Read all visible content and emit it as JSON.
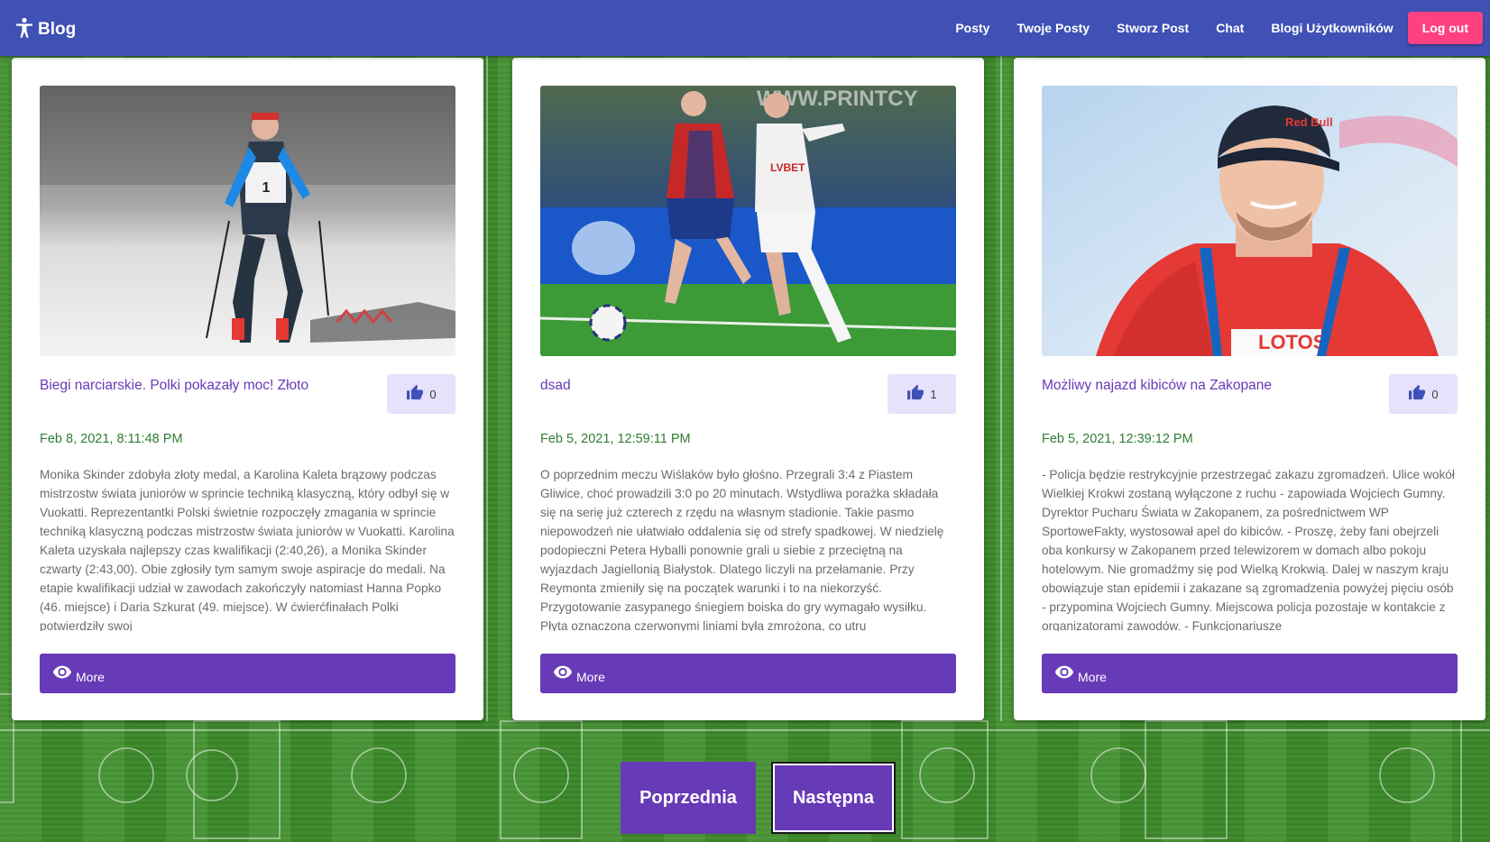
{
  "app": {
    "title": "Blog",
    "icon": "accessibility-icon"
  },
  "nav": {
    "items": [
      {
        "label": "Posty"
      },
      {
        "label": "Twoje Posty"
      },
      {
        "label": "Stworz Post"
      },
      {
        "label": "Chat"
      },
      {
        "label": "Blogi Użytkowników"
      }
    ],
    "logout_label": "Log out"
  },
  "posts": [
    {
      "title": "Biegi narciarskie. Polki pokazały moc! Złoto",
      "likes": "0",
      "date": "Feb 8, 2021, 8:11:48 PM",
      "body": "Monika Skinder zdobyła złoty medal, a Karolina Kaleta brązowy podczas mistrzostw świata juniorów w sprincie techniką klasyczną, który odbył się w Vuokatti. Reprezentantki Polski świetnie rozpoczęły zmagania w sprincie techniką klasyczną podczas mistrzostw świata juniorów w Vuokatti. Karolina Kaleta uzyskała najlepszy czas kwalifikacji (2:40,26), a Monika Skinder czwarty (2:43,00). Obie zgłosiły tym samym swoje aspiracje do medali. Na etapie kwalifikacji udział w zawodach zakończyły natomiast Hanna Popko (46. miejsce) i Daria Szkurat (49. miejsce). W ćwierćfinałach Polki potwierdziły swoj",
      "more_label": "More",
      "image_alt": "cross-country skier"
    },
    {
      "title": "dsad",
      "likes": "1",
      "date": "Feb 5, 2021, 12:59:11 PM",
      "body": "O poprzednim meczu Wiślaków było głośno. Przegrali 3:4 z Piastem Gliwice, choć prowadzili 3:0 po 20 minutach. Wstydliwa porażka składała się na serię już czterech z rzędu na własnym stadionie. Takie pasmo niepowodzeń nie ułatwiało oddalenia się od strefy spadkowej. W niedzielę podopieczni Petera Hyballi ponownie grali u siebie z przeciętną na wyjazdach Jagiellonią Białystok. Dlatego liczyli na przełamanie. Przy Reymonta zmieniły się na początek warunki i to na niekorzyść. Przygotowanie zasypanego śniegiem boiska do gry wymagało wysiłku. Płyta oznaczona czerwonymi liniami była zmrożona, co utru",
      "more_label": "More",
      "image_alt": "football players"
    },
    {
      "title": "Możliwy najazd kibiców na Zakopane",
      "likes": "0",
      "date": "Feb 5, 2021, 12:39:12 PM",
      "body": "- Policja będzie restrykcyjnie przestrzegać zakazu zgromadzeń. Ulice wokół Wielkiej Krokwi zostaną wyłączone z ruchu - zapowiada Wojciech Gumny. Dyrektor Pucharu Świata w Zakopanem, za pośrednictwem WP SportoweFakty, wystosował apel do kibiców. - Proszę, żeby fani obejrzeli oba konkursy w Zakopanem przed telewizorem w domach albo pokoju hotelowym. Nie gromadźmy się pod Wielką Krokwią. Dalej w naszym kraju obowiązuje stan epidemii i zakazane są zgromadzenia powyżej pięciu osób - przypomina Wojciech Gumny. Miejscowa policja pozostaje w kontakcie z organizatorami zawodów. - Funkcjonariusze",
      "more_label": "More",
      "image_alt": "man in red jacket"
    }
  ],
  "pagination": {
    "prev_label": "Poprzednia",
    "next_label": "Następna"
  },
  "colors": {
    "appbar": "#3f51b5",
    "logout": "#ff4081",
    "primary": "#673ab7",
    "like_bg": "#e8e1fb",
    "date": "#2e7d32"
  }
}
